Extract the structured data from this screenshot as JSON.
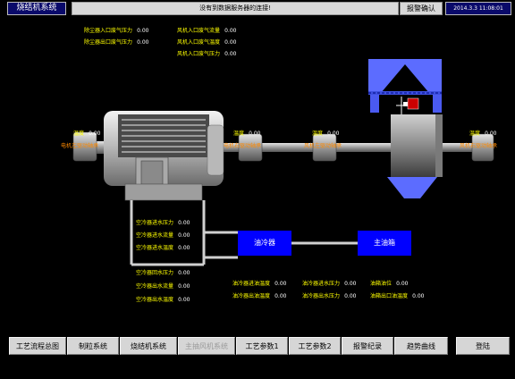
{
  "header": {
    "title": "烧结机系统",
    "message": "没有到数据服务器的连接!",
    "alarm_confirm": "报警确认",
    "datetime": "2014.3.3 11:08:01"
  },
  "readouts": {
    "dust_in_pressure": {
      "label": "除尘器入口废气压力",
      "value": "0.00"
    },
    "dust_out_pressure": {
      "label": "除尘器出口废气压力",
      "value": "0.00"
    },
    "fan_in_flow": {
      "label": "风机入口废气流量",
      "value": "0.00"
    },
    "fan_in_temp": {
      "label": "风机入口废气温度",
      "value": "0.00"
    },
    "fan_in_pressure": {
      "label": "风机入口废气压力",
      "value": "0.00"
    }
  },
  "temps": {
    "t1": {
      "label": "温度",
      "value": "0.00"
    },
    "t2": {
      "label": "温度",
      "value": "0.00"
    },
    "t3": {
      "label": "温度",
      "value": "0.00"
    },
    "t4": {
      "label": "温度",
      "value": "0.00"
    }
  },
  "drive_labels": {
    "motor_left": "电机左驱动轴承",
    "motor_right": "电机右驱动轴承",
    "fan_left": "风机左驱动轴承",
    "fan_right": "风机右驱动轴承"
  },
  "air_cooler": {
    "in_pressure": {
      "label": "空冷器进水压力",
      "value": "0.00"
    },
    "in_flow": {
      "label": "空冷器进水流量",
      "value": "0.00"
    },
    "in_temp": {
      "label": "空冷器进水温度",
      "value": "0.00"
    },
    "out_pressure": {
      "label": "空冷器回水压力",
      "value": "0.00"
    },
    "out_flow": {
      "label": "空冷器出水流量",
      "value": "0.00"
    },
    "out_temp": {
      "label": "空冷器出水温度",
      "value": "0.00"
    }
  },
  "boxes": {
    "oil_cooler": "油冷器",
    "main_tank": "主油箱"
  },
  "oil": {
    "in_temp": {
      "label": "油冷器进油温度",
      "value": "0.00"
    },
    "out_temp": {
      "label": "油冷器出油温度",
      "value": "0.00"
    },
    "in_water_pressure": {
      "label": "油冷器进水压力",
      "value": "0.00"
    },
    "out_water_pressure": {
      "label": "油冷器出水压力",
      "value": "0.00"
    },
    "tank_level": {
      "label": "油箱油位",
      "value": "0.00"
    },
    "tank_oil_temp": {
      "label": "油箱出口油温度",
      "value": "0.00"
    }
  },
  "nav": [
    "工艺流程总图",
    "制粒系统",
    "烧结机系统",
    "主抽风机系统",
    "工艺参数1",
    "工艺参数2",
    "报警纪录",
    "趋势曲线",
    "登陆"
  ],
  "active_nav": "主抽风机系统"
}
